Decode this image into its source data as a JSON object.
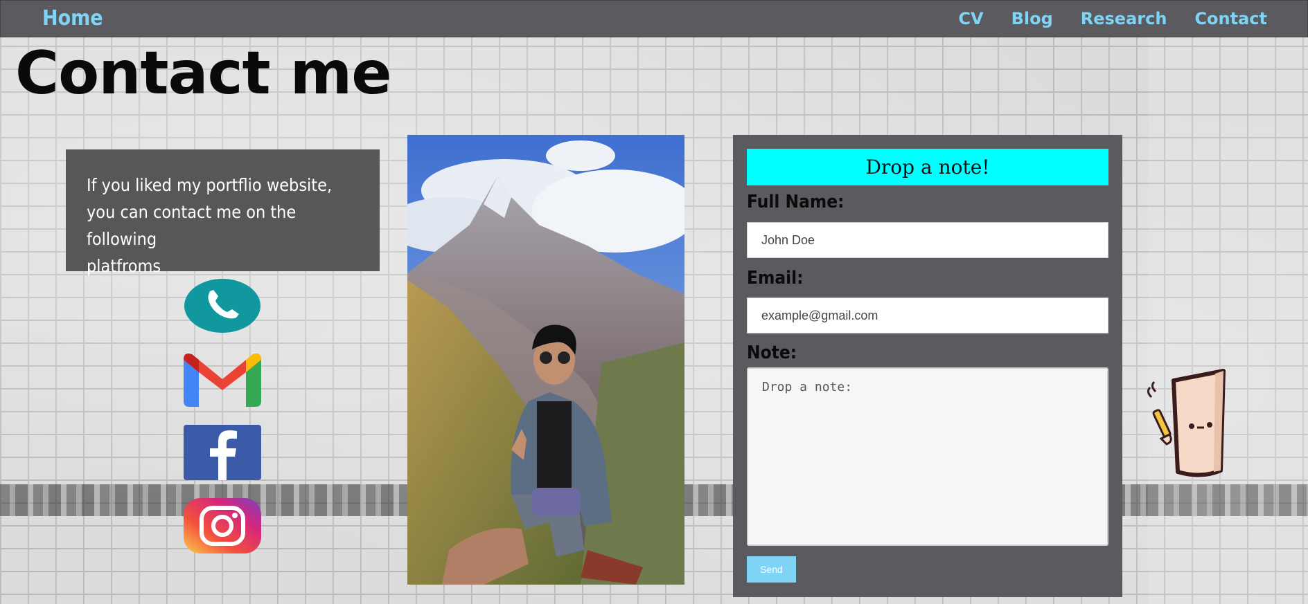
{
  "nav": {
    "home": "Home",
    "links": [
      "CV",
      "Blog",
      "Research",
      "Contact"
    ]
  },
  "page": {
    "title": "Contact me"
  },
  "info": {
    "line1": "If you liked my portflio website,",
    "line2": "you can contact me on the following",
    "line3": "platfroms"
  },
  "social": {
    "icons": [
      "phone-icon",
      "gmail-icon",
      "facebook-icon",
      "instagram-icon"
    ]
  },
  "form": {
    "header": "Drop a note!",
    "name_label": "Full Name:",
    "name_placeholder": "John Doe",
    "email_label": "Email:",
    "email_placeholder": "example@gmail.com",
    "note_label": "Note:",
    "note_placeholder": "Drop a note:",
    "send_label": "Send"
  },
  "colors": {
    "nav_bg": "#5b5b5f",
    "nav_link": "#7fd3f5",
    "form_header": "#00ffff",
    "panel_bg": "#575757",
    "send_btn": "#7fd3f5"
  }
}
